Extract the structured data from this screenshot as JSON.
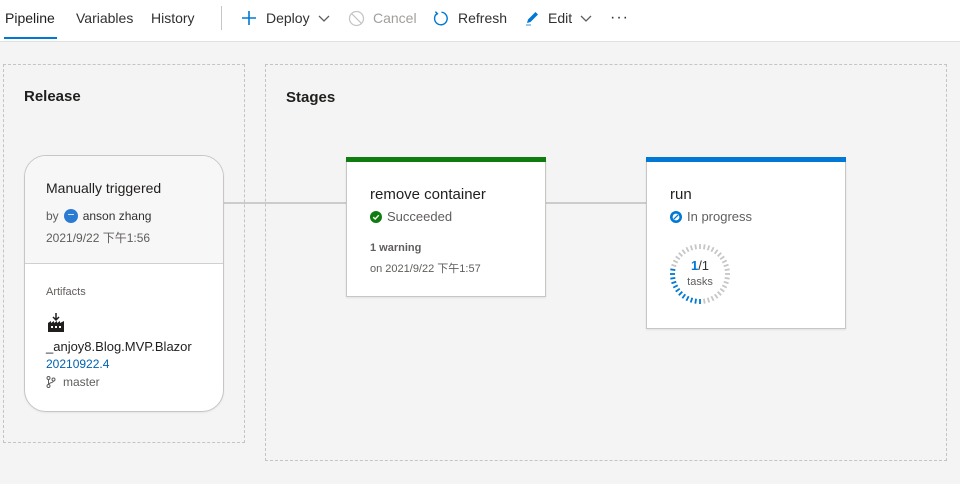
{
  "tabs": [
    {
      "label": "Pipeline",
      "active": true
    },
    {
      "label": "Variables",
      "active": false
    },
    {
      "label": "History",
      "active": false
    }
  ],
  "commands": {
    "deploy": "Deploy",
    "cancel": "Cancel",
    "refresh": "Refresh",
    "edit": "Edit",
    "more": "···"
  },
  "release": {
    "panel_title": "Release",
    "trigger": "Manually triggered",
    "by_prefix": "by",
    "user": "anson zhang",
    "date": "2021/9/22 下午1:56",
    "artifacts_label": "Artifacts",
    "artifact_name": "_anjoy8.Blog.MVP.Blazor",
    "artifact_version": "20210922.4",
    "branch": "master"
  },
  "stages": {
    "panel_title": "Stages",
    "items": [
      {
        "name": "remove container",
        "status": "Succeeded",
        "status_color": "#107c10",
        "warning": "1 warning",
        "completed": "on 2021/9/22 下午1:57"
      },
      {
        "name": "run",
        "status": "In progress",
        "status_color": "#0078d4",
        "tasks_done": "1",
        "tasks_total": "/1",
        "tasks_label": "tasks"
      }
    ]
  },
  "colors": {
    "accent": "#0078d4",
    "success": "#107c10"
  }
}
